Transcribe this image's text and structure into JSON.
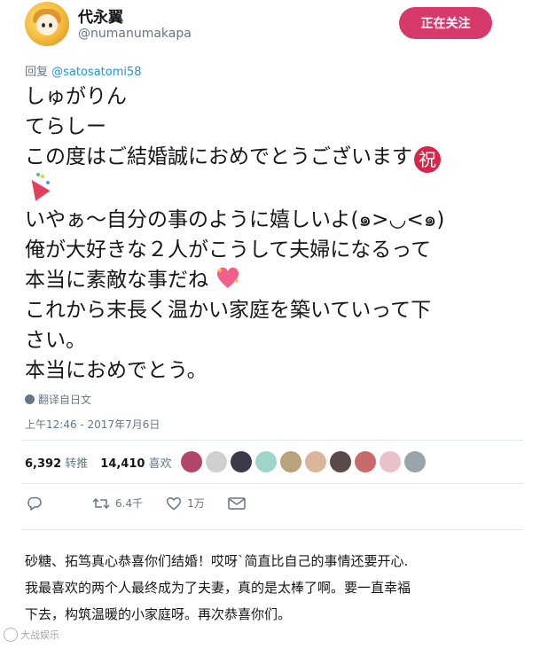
{
  "header": {
    "display_name": "代永翼",
    "handle": "@numanumakapa",
    "follow_label": "正在关注"
  },
  "reply": {
    "prefix": "回复 ",
    "mention": "@satosatomi58"
  },
  "tweet": {
    "lines": [
      "しゅがりん",
      "てらしー",
      "この度はご結婚誠におめでとうございます",
      "いやぁ〜自分の事のように嬉しいよ(๑>◡<๑)",
      "俺が大好きな２人がこうして夫婦になるって",
      "本当に素敵な事だね",
      "これから末長く温かい家庭を築いていって下",
      "さい。",
      "本当におめでとう。"
    ],
    "emoji_iwai": "祝"
  },
  "translate_label": "翻译自日文",
  "timestamp": "上午12:46 - 2017年7月6日",
  "stats": {
    "retweet_count": "6,392",
    "retweet_label": "转推",
    "like_count": "14,410",
    "like_label": "喜欢"
  },
  "likers": {
    "colors": [
      "#b3476a",
      "#cfcfcf",
      "#3a3a4a",
      "#9fd4c8",
      "#b9a37a",
      "#d8b59b",
      "#5b4a4a",
      "#c96a6a",
      "#e9c2c9",
      "#9aa4ad"
    ]
  },
  "actions": {
    "reply_icon": "reply-icon",
    "retweet_count": "6.4千",
    "like_count": "1万",
    "message_icon": "envelope-icon"
  },
  "translation": {
    "lines": [
      "砂糖、拓笃真心恭喜你们结婚！哎呀`简直比自己的事情还要开心.",
      "我最喜欢的两个人最终成为了夫妻，真的是太棒了啊。要一直幸福",
      "下去，构筑温暖的小家庭呀。再次恭喜你们。"
    ]
  },
  "watermark": {
    "text": "大战娱乐"
  }
}
